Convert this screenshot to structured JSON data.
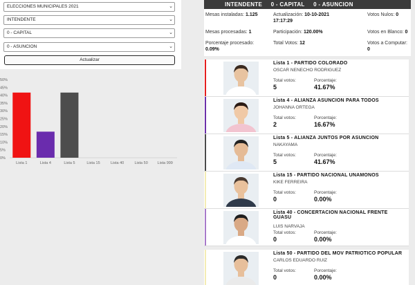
{
  "filters": {
    "election": "ELECCIONES MUNICIPALES 2021",
    "office": "INTENDENTE",
    "department": "0 - CAPITAL",
    "district": "0 - ASUNCION",
    "update_button": "Actualizar"
  },
  "header": {
    "office": "INTENDENTE",
    "department": "0 - CAPITAL",
    "district": "0 - ASUNCION"
  },
  "stats": {
    "mesas_instaladas_label": "Mesas instaladas:",
    "mesas_instaladas_value": "1.125",
    "actualizacion_label": "Actualización:",
    "actualizacion_date": "10-10-2021",
    "actualizacion_time": "17:17:29",
    "votos_nulos_label": "Votos Nulos:",
    "votos_nulos_value": "0",
    "mesas_procesadas_label": "Mesas procesadas:",
    "mesas_procesadas_value": "1",
    "participacion_label": "Participación:",
    "participacion_value": "120.00%",
    "votos_blanco_label": "Votos en Blanco:",
    "votos_blanco_value": "0",
    "porcentaje_label": "Porcentaje procesado:",
    "porcentaje_value": "0.09%",
    "total_votos_label": "Total Votos:",
    "total_votos_value": "12",
    "votos_computar_label": "Votos a Computar:",
    "votos_computar_value": "0"
  },
  "cards": [
    {
      "list": "Lista 1 - PARTIDO COLORADO",
      "candidate": "OSCAR NENECHO RODRIGUEZ",
      "votes": "5",
      "percent": "41.67%",
      "color": "#e41e1e"
    },
    {
      "list": "Lista 4 - ALIANZA ASUNCION PARA TODOS",
      "candidate": "JOHANNA ORTEGA",
      "votes": "2",
      "percent": "16.67%",
      "color": "#6b2fa8"
    },
    {
      "list": "Lista 5 - ALIANZA JUNTOS POR ASUNCION",
      "candidate": "NAKAYAMA",
      "votes": "5",
      "percent": "41.67%",
      "color": "#4a4a4a"
    },
    {
      "list": "Lista 15 - PARTIDO NACIONAL UNAMONOS",
      "candidate": "KIKE FERREIRA",
      "votes": "0",
      "percent": "0.00%",
      "color": "#f3ecb4"
    },
    {
      "list": "Lista 40 - CONCERTACION NACIONAL FRENTE GUASU",
      "candidate": "LUIS NARVAJA",
      "votes": "0",
      "percent": "0.00%",
      "color": "#a779c9"
    },
    {
      "list": "Lista 50 - PARTIDO DEL MOV PATRIOTICO POPULAR",
      "candidate": "CARLOS EDUARDO RUIZ",
      "votes": "0",
      "percent": "0.00%",
      "color": "#f3ecb4"
    }
  ],
  "labels": {
    "total_votos": "Total votos:",
    "porcentaje": "Porcentaje:"
  },
  "chart_data": {
    "type": "bar",
    "categories": [
      "Lista 1",
      "Lista 4",
      "Lista 5",
      "Lista 15",
      "Lista 40",
      "Lista 50",
      "Lista 999"
    ],
    "values": [
      41.67,
      16.67,
      41.67,
      0,
      0,
      0,
      0
    ],
    "colors": [
      "#f01313",
      "#6a2cad",
      "#4d4d4d",
      "#f01313",
      "#f01313",
      "#f01313",
      "#f01313"
    ],
    "y_ticks": [
      "0%",
      "5%",
      "10%",
      "15%",
      "20%",
      "25%",
      "30%",
      "35%",
      "40%",
      "45%",
      "50%"
    ],
    "ylim": [
      0,
      50
    ],
    "grid": false
  }
}
